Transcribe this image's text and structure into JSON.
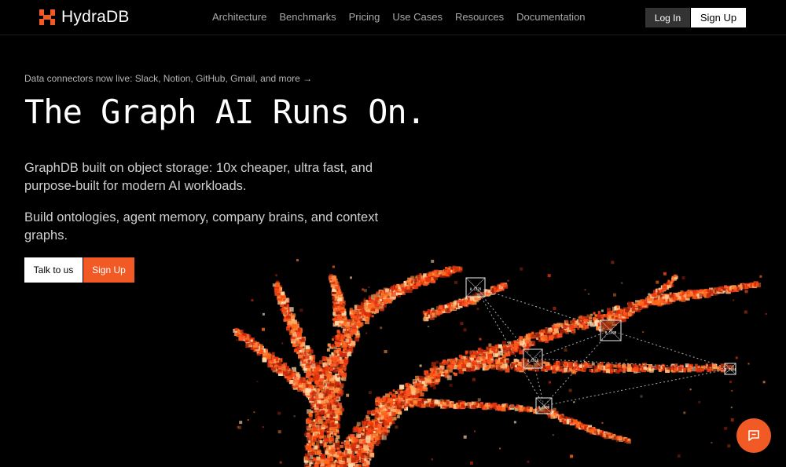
{
  "brand": {
    "name": "HydraDB",
    "accent": "#f15a24"
  },
  "nav": {
    "links": [
      "Architecture",
      "Benchmarks",
      "Pricing",
      "Use Cases",
      "Resources",
      "Documentation"
    ],
    "login": "Log In",
    "signup": "Sign Up"
  },
  "hero": {
    "announcement": "Data connectors now live: Slack, Notion, GitHub, Gmail, and more →",
    "title": "The Graph AI Runs On.",
    "description": "GraphDB built on object storage: 10x cheaper, ultra fast, and purpose-built for modern AI workloads.",
    "description2": "Build ontologies, agent memory, company brains, and context graphs.",
    "cta_primary": "Talk to us",
    "cta_secondary": "Sign Up"
  },
  "graphic": {
    "node_labels": [
      "0_1123",
      "0_1400",
      "0_1414",
      "0_1000",
      "0_2164"
    ]
  },
  "chat": {
    "icon": "chat-bubble-icon"
  }
}
